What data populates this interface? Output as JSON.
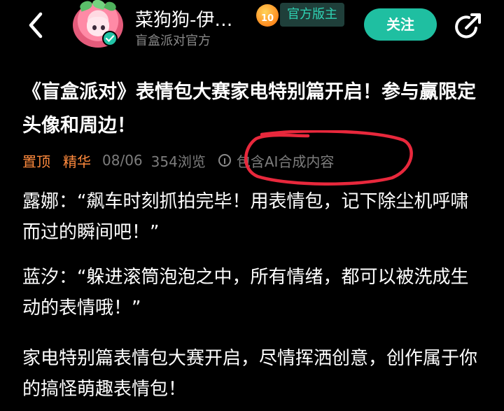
{
  "header": {
    "back_icon": "chevron-left-icon",
    "username": "菜狗狗-伊…",
    "user_subtitle": "盲盒派对官方",
    "level_badge": "10",
    "official_tag": "官方版主",
    "follow_label": "关注",
    "share_icon": "share-icon",
    "accent_color": "#1fbfa1"
  },
  "post": {
    "title": "《盲盒派对》表情包大赛家电特别篇开启！参与赢限定头像和周边！",
    "meta": {
      "pinned": "置顶",
      "essence": "精华",
      "date": "08/06",
      "views": "354浏览",
      "ai_notice": "包含AI合成内容"
    },
    "paragraphs": [
      "露娜：“飙车时刻抓拍完毕！用表情包，记下除尘机呼啸而过的瞬间吧！”",
      "蓝汐：“躲进滚筒泡泡之中，所有情绪，都可以被洗成生动的表情哦！”",
      "家电特别篇表情包大赛开启，尽情挥洒创意，创作属于你的搞怪萌趣表情包！"
    ]
  },
  "colors": {
    "background": "#000000",
    "tag_orange": "#ff8a3d",
    "meta_gray": "#7d7d7d",
    "annotation_red": "#e8283c"
  }
}
